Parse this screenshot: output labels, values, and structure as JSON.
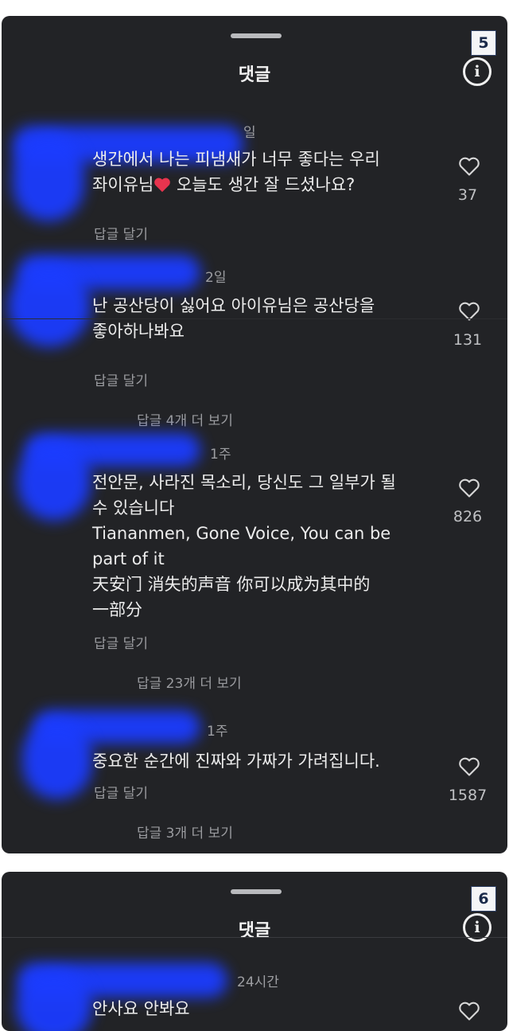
{
  "screens": [
    {
      "badge": "5",
      "title": "댓글",
      "comments": [
        {
          "time": "일",
          "text_lines": [
            "생간에서 나는 피냄새가 너무 좋다는 우리",
            "좌이유님",
            " 오늘도 생간 잘 드셨나요?"
          ],
          "reply": "답글 달기",
          "likes": "37"
        },
        {
          "time": "2일",
          "text_lines": [
            "난 공산당이 싫어요 아이유님은 공산당을",
            "좋아하나봐요"
          ],
          "reply": "답글 달기",
          "more": "답글 4개 더 보기",
          "likes": "131"
        },
        {
          "time": "1주",
          "text_lines": [
            "전안문, 사라진 목소리, 당신도 그 일부가 될",
            "수 있습니다",
            "Tiananmen, Gone Voice, You can be",
            "part of it",
            "天安门 消失的声音 你可以成为其中的",
            "一部分"
          ],
          "reply": "답글 달기",
          "more": "답글 23개 더 보기",
          "likes": "826"
        },
        {
          "time": "1주",
          "text_lines": [
            "중요한 순간에 진짜와 가짜가 가려집니다."
          ],
          "reply": "답글 달기",
          "more": "답글 3개 더 보기",
          "likes": "1587"
        }
      ]
    },
    {
      "badge": "6",
      "title": "댓글",
      "comments": [
        {
          "time": "24시간",
          "text_lines": [
            "안사요 안봐요"
          ]
        }
      ]
    }
  ],
  "colors": {
    "panel_bg": "#222326",
    "redaction": "#1b3cff",
    "heart_emoji": "#e8344e"
  },
  "icons": [
    "heart-icon",
    "info-icon",
    "drag-handle",
    "heart-emoji"
  ]
}
